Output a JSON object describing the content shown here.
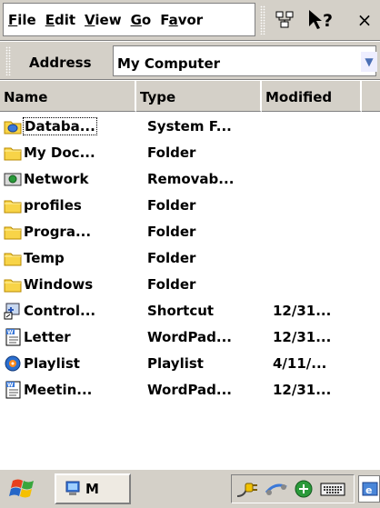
{
  "menubar": {
    "items": [
      {
        "pre": "",
        "ul": "F",
        "post": "ile"
      },
      {
        "pre": "",
        "ul": "E",
        "post": "dit"
      },
      {
        "pre": "",
        "ul": "V",
        "post": "iew"
      },
      {
        "pre": "",
        "ul": "G",
        "post": "o"
      },
      {
        "pre": "F",
        "ul": "a",
        "post": "vor"
      }
    ],
    "close_label": "×"
  },
  "address": {
    "label": "Address",
    "value": "My Computer"
  },
  "columns": {
    "name": "Name",
    "type": "Type",
    "modified": "Modified"
  },
  "files": [
    {
      "name": "Databa...",
      "type": "System F...",
      "modified": "",
      "icon": "database-folder-icon"
    },
    {
      "name": "My Doc...",
      "type": "Folder",
      "modified": "",
      "icon": "folder-icon"
    },
    {
      "name": "Network",
      "type": "Removab...",
      "modified": "",
      "icon": "network-drive-icon"
    },
    {
      "name": "profiles",
      "type": "Folder",
      "modified": "",
      "icon": "folder-icon"
    },
    {
      "name": "Progra...",
      "type": "Folder",
      "modified": "",
      "icon": "folder-icon"
    },
    {
      "name": "Temp",
      "type": "Folder",
      "modified": "",
      "icon": "folder-icon"
    },
    {
      "name": "Windows",
      "type": "Folder",
      "modified": "",
      "icon": "folder-icon"
    },
    {
      "name": "Control...",
      "type": "Shortcut",
      "modified": "12/31...",
      "icon": "shortcut-icon"
    },
    {
      "name": "Letter",
      "type": "WordPad...",
      "modified": "12/31...",
      "icon": "wordpad-document-icon"
    },
    {
      "name": "Playlist",
      "type": "Playlist",
      "modified": "4/11/...",
      "icon": "playlist-icon"
    },
    {
      "name": "Meetin...",
      "type": "WordPad...",
      "modified": "12/31...",
      "icon": "wordpad-document-icon"
    }
  ],
  "taskbar": {
    "task_label": "M"
  }
}
